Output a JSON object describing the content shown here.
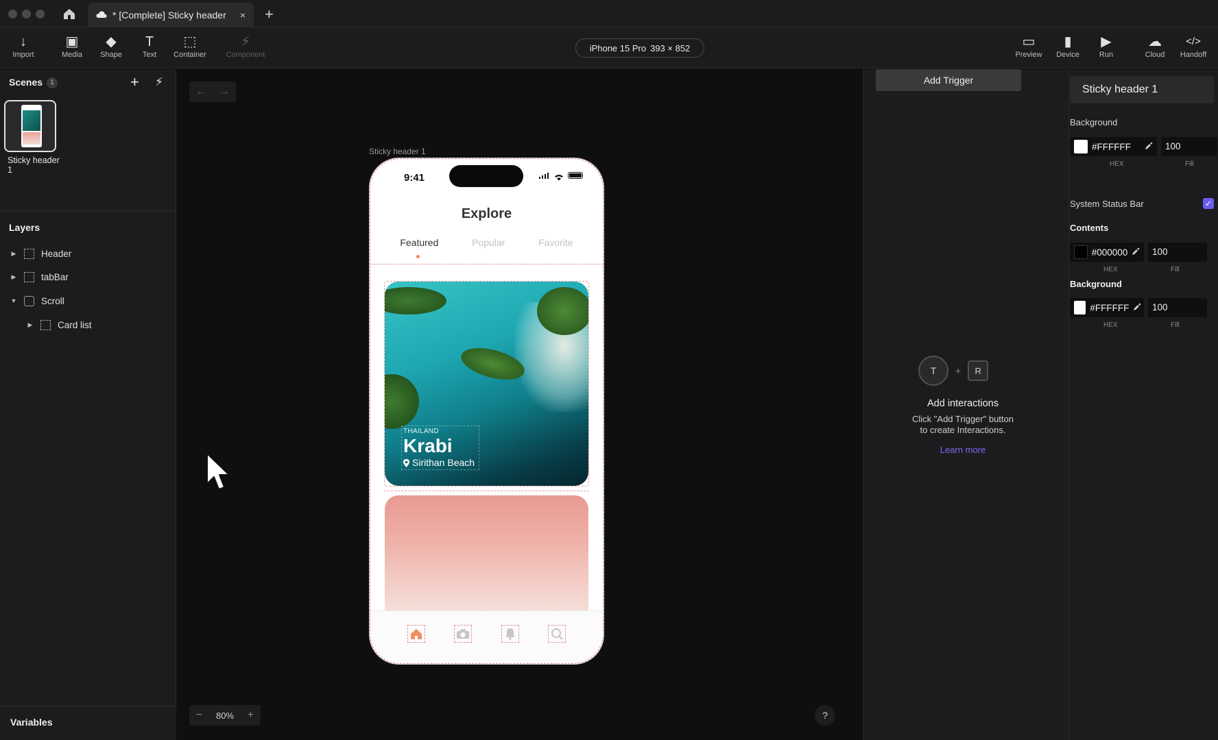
{
  "window": {
    "tab_title": "* [Complete] Sticky header",
    "tab_close": "×",
    "new_tab": "+"
  },
  "toolbar": {
    "left_tools": [
      {
        "name": "import",
        "label": "Import",
        "icon": "↓"
      },
      {
        "name": "media",
        "label": "Media",
        "icon": "▣"
      },
      {
        "name": "shape",
        "label": "Shape",
        "icon": "◆"
      },
      {
        "name": "text",
        "label": "Text",
        "icon": "T"
      },
      {
        "name": "container",
        "label": "Container",
        "icon": "⬚"
      },
      {
        "name": "component",
        "label": "Component",
        "icon": "⚡"
      }
    ],
    "device_name": "iPhone 15 Pro",
    "device_size": "393 × 852",
    "right_tools": [
      {
        "name": "preview",
        "label": "Preview",
        "icon": "▭"
      },
      {
        "name": "device",
        "label": "Device",
        "icon": "▮"
      },
      {
        "name": "run",
        "label": "Run",
        "icon": "▶"
      },
      {
        "name": "cloud",
        "label": "Cloud",
        "icon": "☁"
      },
      {
        "name": "handoff",
        "label": "Handoff",
        "icon": "</>"
      }
    ]
  },
  "scenes": {
    "title": "Scenes",
    "count": "1",
    "add": "+",
    "trigger": "⚡",
    "items": [
      {
        "label": "Sticky header 1"
      }
    ]
  },
  "layers": {
    "title": "Layers",
    "items": [
      {
        "label": "Header",
        "chevron": "▶"
      },
      {
        "label": "tabBar",
        "chevron": "▶"
      },
      {
        "label": "Scroll",
        "chevron": "▼"
      },
      {
        "label": "Card list",
        "chevron": "▶"
      }
    ]
  },
  "variables": {
    "title": "Variables"
  },
  "canvas": {
    "back": "←",
    "forward": "→",
    "frame_label": "Sticky header 1",
    "zoom_out": "−",
    "zoom_level": "80%",
    "zoom_in": "+",
    "help": "?"
  },
  "phone": {
    "time": "9:41",
    "title": "Explore",
    "tabs": [
      "Featured",
      "Popular",
      "Favorite"
    ],
    "card": {
      "country": "THAILAND",
      "place": "Krabi",
      "beach": "Sirithan Beach"
    }
  },
  "interactions": {
    "add_trigger": "Add Trigger",
    "t_label": "T",
    "plus": "+",
    "r_label": "R",
    "title": "Add interactions",
    "desc_line1": "Click \"Add Trigger\" button",
    "desc_line2": "to create Interactions.",
    "learn_more": "Learn more"
  },
  "properties": {
    "scene_name": "Sticky header 1",
    "background_label": "Background",
    "background_hex": "#FFFFFF",
    "background_fill": "100",
    "hex_sub": "HEX",
    "fill_sub": "Fill",
    "status_bar_label": "System Status Bar",
    "status_bar_checked": "✓",
    "contents_label": "Contents",
    "contents_hex": "#000000",
    "contents_fill": "100",
    "background2_label": "Background",
    "background2_hex": "#FFFFFF",
    "background2_fill": "100"
  },
  "colors": {
    "accent": "#6b5cf0",
    "link": "#7b6cf5",
    "tab_indicator": "#f08a5d"
  }
}
